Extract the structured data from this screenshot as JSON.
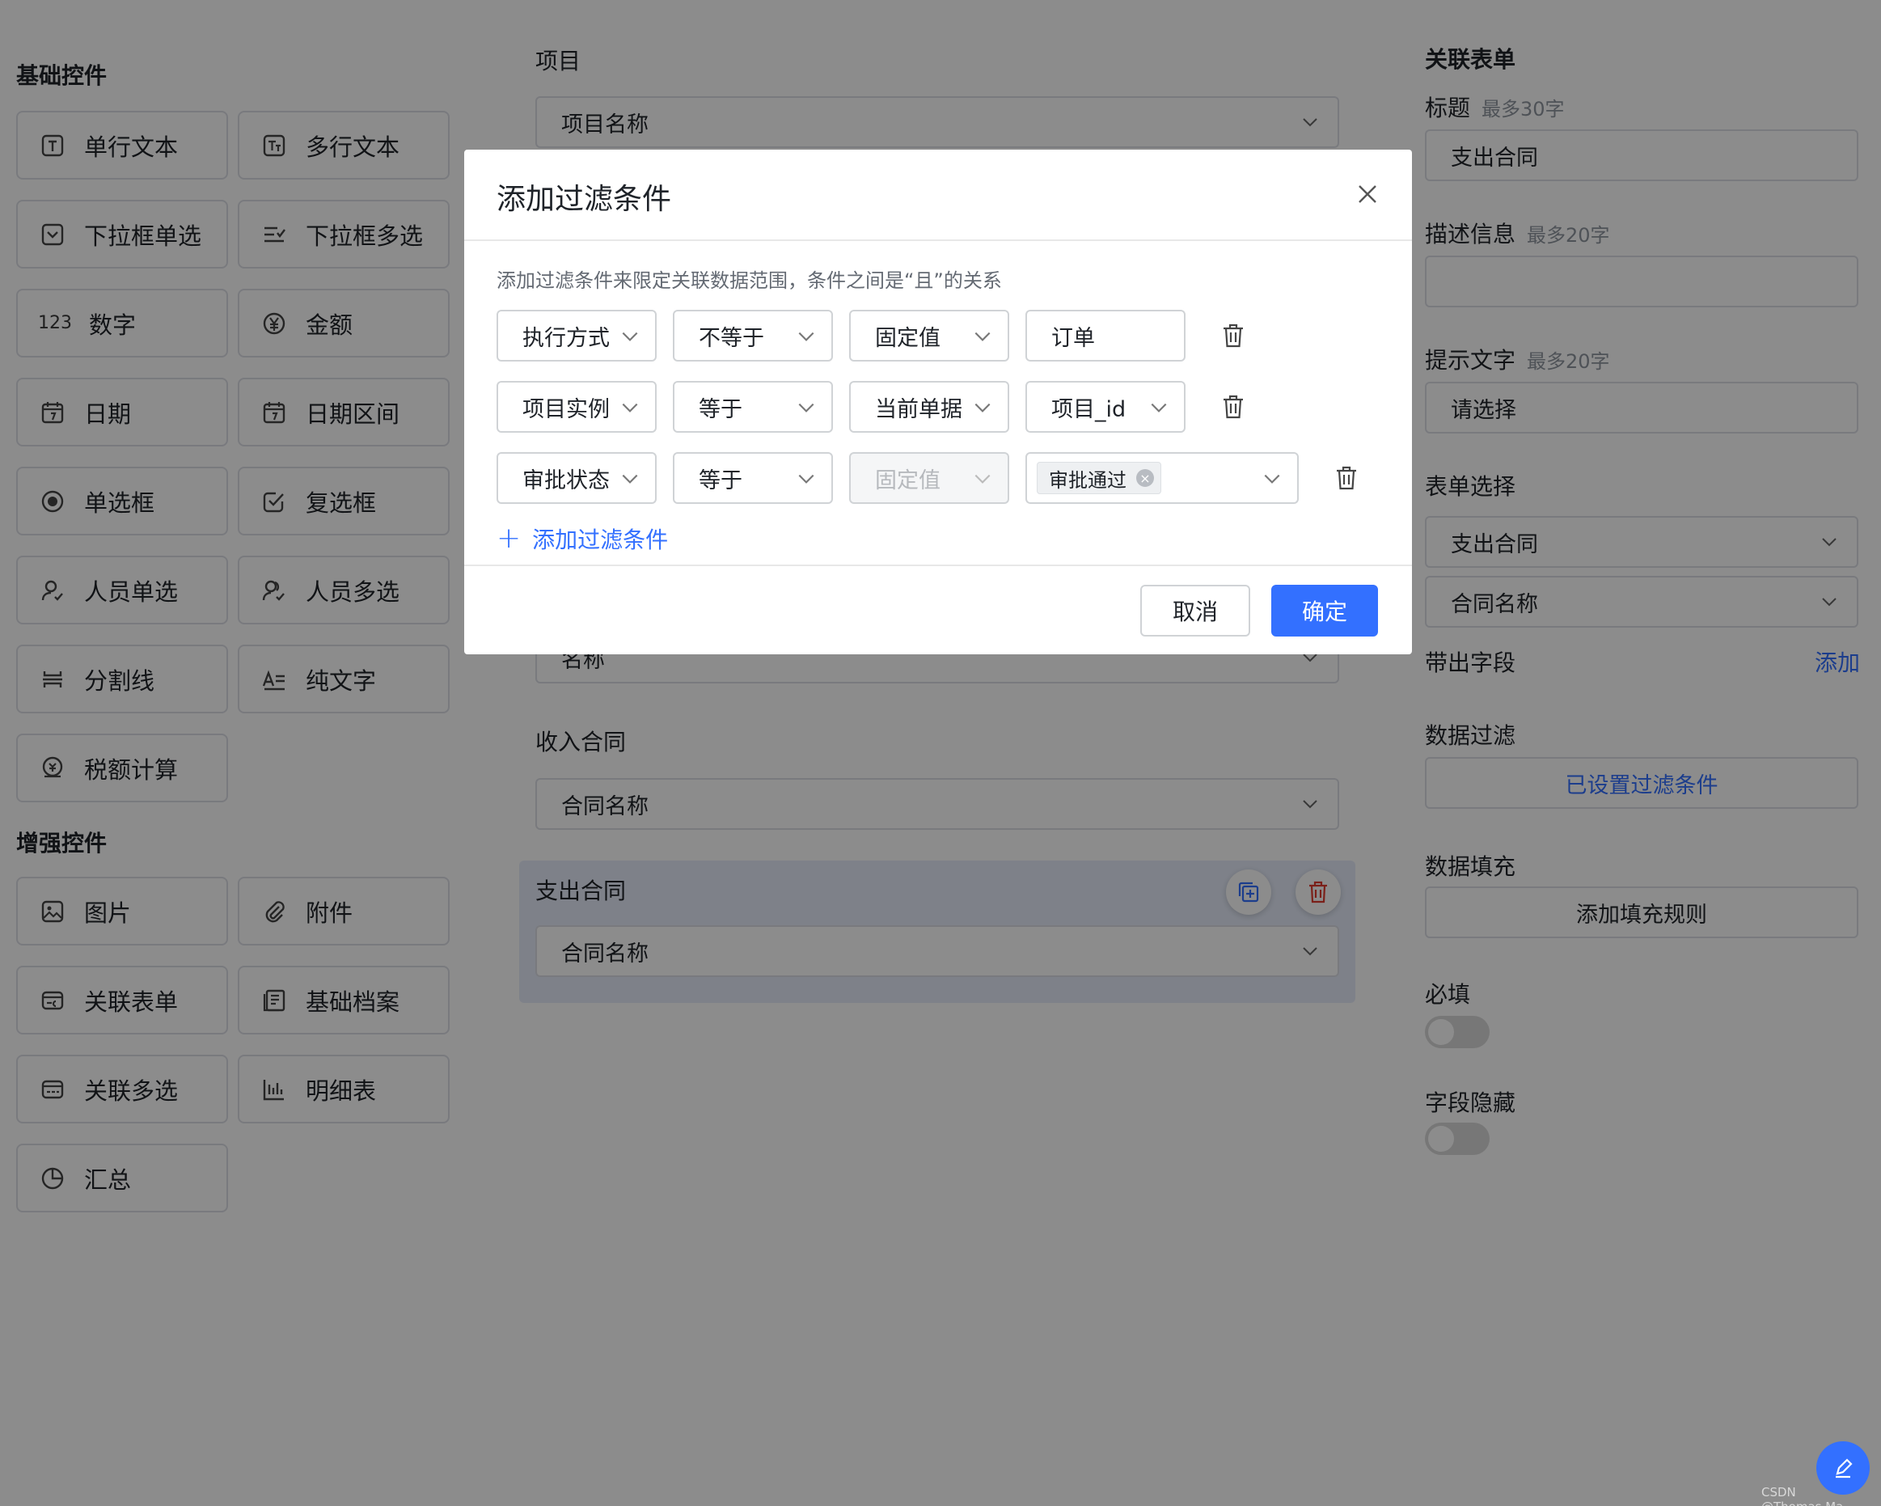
{
  "left_panel": {
    "basic_title": "基础控件",
    "basic_controls": [
      {
        "label": "单行文本",
        "icon": "single-line-text-icon"
      },
      {
        "label": "多行文本",
        "icon": "multi-line-text-icon"
      },
      {
        "label": "下拉框单选",
        "icon": "dropdown-single-icon"
      },
      {
        "label": "下拉框多选",
        "icon": "dropdown-multi-icon"
      },
      {
        "label": "数字",
        "icon": "number-icon",
        "glyph": "123"
      },
      {
        "label": "金额",
        "icon": "amount-icon"
      },
      {
        "label": "日期",
        "icon": "date-icon"
      },
      {
        "label": "日期区间",
        "icon": "date-range-icon"
      },
      {
        "label": "单选框",
        "icon": "radio-icon"
      },
      {
        "label": "复选框",
        "icon": "checkbox-icon"
      },
      {
        "label": "人员单选",
        "icon": "person-single-icon"
      },
      {
        "label": "人员多选",
        "icon": "person-multi-icon"
      },
      {
        "label": "分割线",
        "icon": "divider-icon"
      },
      {
        "label": "纯文字",
        "icon": "plain-text-icon"
      },
      {
        "label": "税额计算",
        "icon": "tax-calc-icon"
      }
    ],
    "enhanced_title": "增强控件",
    "enhanced_controls": [
      {
        "label": "图片",
        "icon": "image-icon"
      },
      {
        "label": "附件",
        "icon": "attachment-icon"
      },
      {
        "label": "关联表单",
        "icon": "linked-form-icon"
      },
      {
        "label": "基础档案",
        "icon": "archive-icon"
      },
      {
        "label": "关联多选",
        "icon": "linked-multi-icon"
      },
      {
        "label": "明细表",
        "icon": "detail-table-icon"
      },
      {
        "label": "汇总",
        "icon": "summary-icon"
      }
    ]
  },
  "center_panel": {
    "project_label": "项目",
    "project_placeholder": "项目名称",
    "hidden_select_value": "名称",
    "income_label": "收入合同",
    "income_placeholder": "合同名称",
    "expense_label": "支出合同",
    "expense_placeholder": "合同名称"
  },
  "right_panel": {
    "title": "关联表单",
    "title_label": "标题",
    "title_hint": "最多30字",
    "title_value": "支出合同",
    "desc_label": "描述信息",
    "desc_hint": "最多20字",
    "desc_value": "",
    "prompt_label": "提示文字",
    "prompt_hint": "最多20字",
    "prompt_value": "请选择",
    "form_select_label": "表单选择",
    "form_select_value": "支出合同",
    "field_select_value": "合同名称",
    "carry_label": "带出字段",
    "carry_add": "添加",
    "filter_label": "数据过滤",
    "filter_button": "已设置过滤条件",
    "fill_label": "数据填充",
    "fill_button": "添加填充规则",
    "required_label": "必填",
    "hidden_label": "字段隐藏"
  },
  "modal": {
    "title": "添加过滤条件",
    "description": "添加过滤条件来限定关联数据范围，条件之间是“且”的关系",
    "conditions": [
      {
        "field": "执行方式",
        "operator": "不等于",
        "value_type": "固定值",
        "value": "订单"
      },
      {
        "field": "项目实例",
        "operator": "等于",
        "value_type": "当前单据",
        "value": "项目_id"
      },
      {
        "field": "审批状态",
        "operator": "等于",
        "value_type": "固定值",
        "value_tag": "审批通过"
      }
    ],
    "add_condition": "添加过滤条件",
    "cancel": "取消",
    "confirm": "确定"
  },
  "watermark": "CSDN @Thomas.Ma",
  "colors": {
    "primary": "#3370ff",
    "overlay": "rgba(0,0,0,0.45)",
    "highlight": "#e6ecfa"
  }
}
